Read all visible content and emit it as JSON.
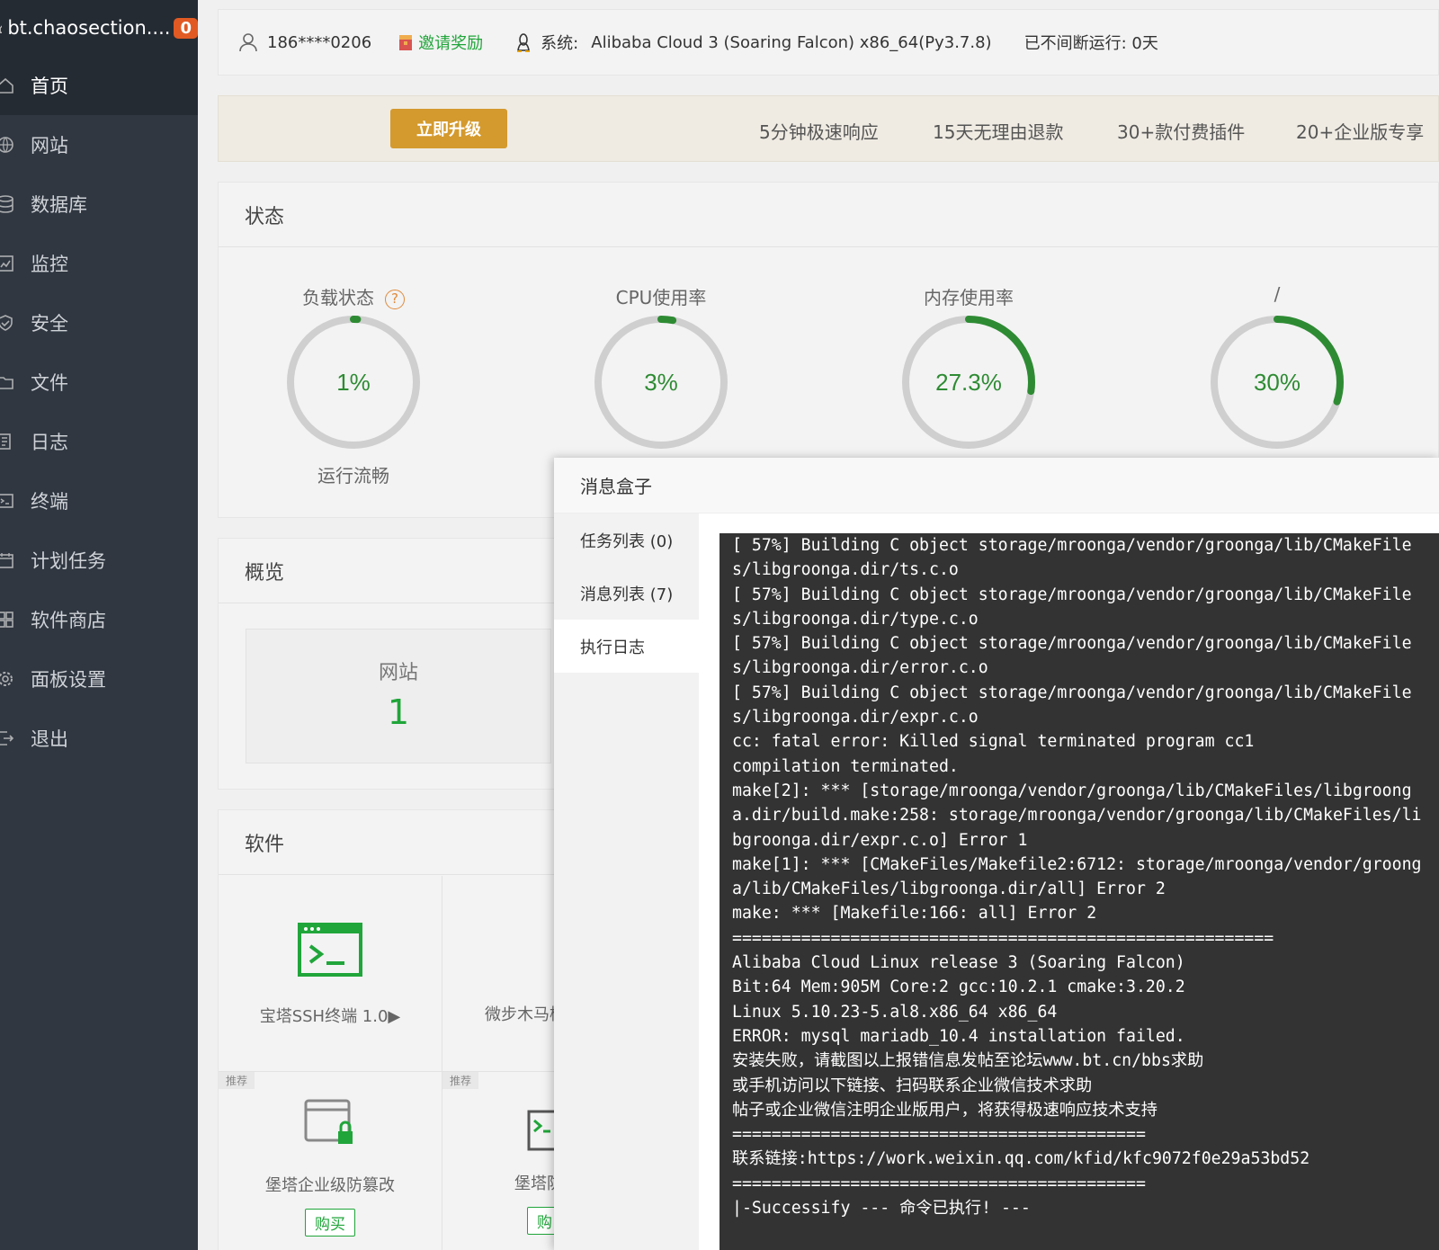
{
  "sidebar": {
    "host": "bt.chaosection....",
    "badge": "0",
    "items": [
      {
        "label": "首页",
        "icon": "home-icon"
      },
      {
        "label": "网站",
        "icon": "globe-icon"
      },
      {
        "label": "数据库",
        "icon": "database-icon"
      },
      {
        "label": "监控",
        "icon": "monitor-icon"
      },
      {
        "label": "安全",
        "icon": "shield-icon"
      },
      {
        "label": "文件",
        "icon": "folder-icon"
      },
      {
        "label": "日志",
        "icon": "log-icon"
      },
      {
        "label": "终端",
        "icon": "terminal-icon"
      },
      {
        "label": "计划任务",
        "icon": "calendar-icon"
      },
      {
        "label": "软件商店",
        "icon": "apps-icon"
      },
      {
        "label": "面板设置",
        "icon": "gear-icon"
      },
      {
        "label": "退出",
        "icon": "logout-icon"
      }
    ]
  },
  "topbar": {
    "user": "186****0206",
    "invite": "邀请奖励",
    "system_label": "系统:",
    "system_value": "Alibaba Cloud 3 (Soaring Falcon) x86_64(Py3.7.8)",
    "uptime": "已不间断运行: 0天"
  },
  "promo": {
    "upgrade": "立即升级",
    "features": [
      "5分钟极速响应",
      "15天无理由退款",
      "30+款付费插件",
      "20+企业版专享"
    ]
  },
  "status": {
    "title": "状态",
    "gauges": [
      {
        "label": "负载状态",
        "value": "1%",
        "fraction": 0.01,
        "sub": "运行流畅"
      },
      {
        "label": "CPU使用率",
        "value": "3%",
        "fraction": 0.03,
        "sub": ""
      },
      {
        "label": "内存使用率",
        "value": "27.3%",
        "fraction": 0.273,
        "sub": ""
      },
      {
        "label": "/",
        "value": "30%",
        "fraction": 0.3,
        "sub": ""
      }
    ]
  },
  "overview": {
    "title": "概览",
    "website_label": "网站",
    "website_count": "1"
  },
  "software": {
    "title": "软件",
    "items": [
      {
        "name": "宝塔SSH终端 1.0▶"
      },
      {
        "name": "微步木马检"
      }
    ],
    "recommended": [
      {
        "tag": "推荐",
        "name": "堡塔企业级防篡改",
        "buy": "购买"
      },
      {
        "tag": "推荐",
        "name": "堡塔防",
        "buy": "购"
      }
    ]
  },
  "dialog": {
    "title": "消息盒子",
    "tabs": [
      "任务列表 (0)",
      "消息列表 (7)",
      "执行日志"
    ],
    "log_lines": [
      "[ 57%] Building C object storage/mroonga/vendor/groonga/lib/CMakeFile",
      "s/libgroonga.dir/ts.c.o",
      "[ 57%] Building C object storage/mroonga/vendor/groonga/lib/CMakeFile",
      "s/libgroonga.dir/type.c.o",
      "[ 57%] Building C object storage/mroonga/vendor/groonga/lib/CMakeFile",
      "s/libgroonga.dir/error.c.o",
      "[ 57%] Building C object storage/mroonga/vendor/groonga/lib/CMakeFile",
      "s/libgroonga.dir/expr.c.o",
      "cc: fatal error: Killed signal terminated program cc1",
      "compilation terminated.",
      "make[2]: *** [storage/mroonga/vendor/groonga/lib/CMakeFiles/libgroong",
      "a.dir/build.make:258: storage/mroonga/vendor/groonga/lib/CMakeFiles/li",
      "bgroonga.dir/expr.c.o] Error 1",
      "make[1]: *** [CMakeFiles/Makefile2:6712: storage/mroonga/vendor/groong",
      "a/lib/CMakeFiles/libgroonga.dir/all] Error 2",
      "make: *** [Makefile:166: all] Error 2",
      "=======================================================",
      "Alibaba Cloud Linux release 3 (Soaring Falcon)",
      "Bit:64 Mem:905M Core:2 gcc:10.2.1 cmake:3.20.2",
      "Linux 5.10.23-5.al8.x86_64 x86_64",
      "ERROR: mysql mariadb_10.4 installation failed.",
      "安装失败，请截图以上报错信息发帖至论坛www.bt.cn/bbs求助",
      "或手机访问以下链接、扫码联系企业微信技术求助",
      "帖子或企业微信注明企业版用户，将获得极速响应技术支持",
      "==========================================",
      "联系链接:https://work.weixin.qq.com/kfid/kfc9072f0e29a53bd52",
      "==========================================",
      "|-Successify --- 命令已执行! ---"
    ]
  },
  "colors": {
    "sidebar_bg": "#303741",
    "accent_green": "#20a53a",
    "gauge_green": "#2e8b33",
    "upgrade_orange": "#d49a2e",
    "console_bg": "#333333"
  }
}
